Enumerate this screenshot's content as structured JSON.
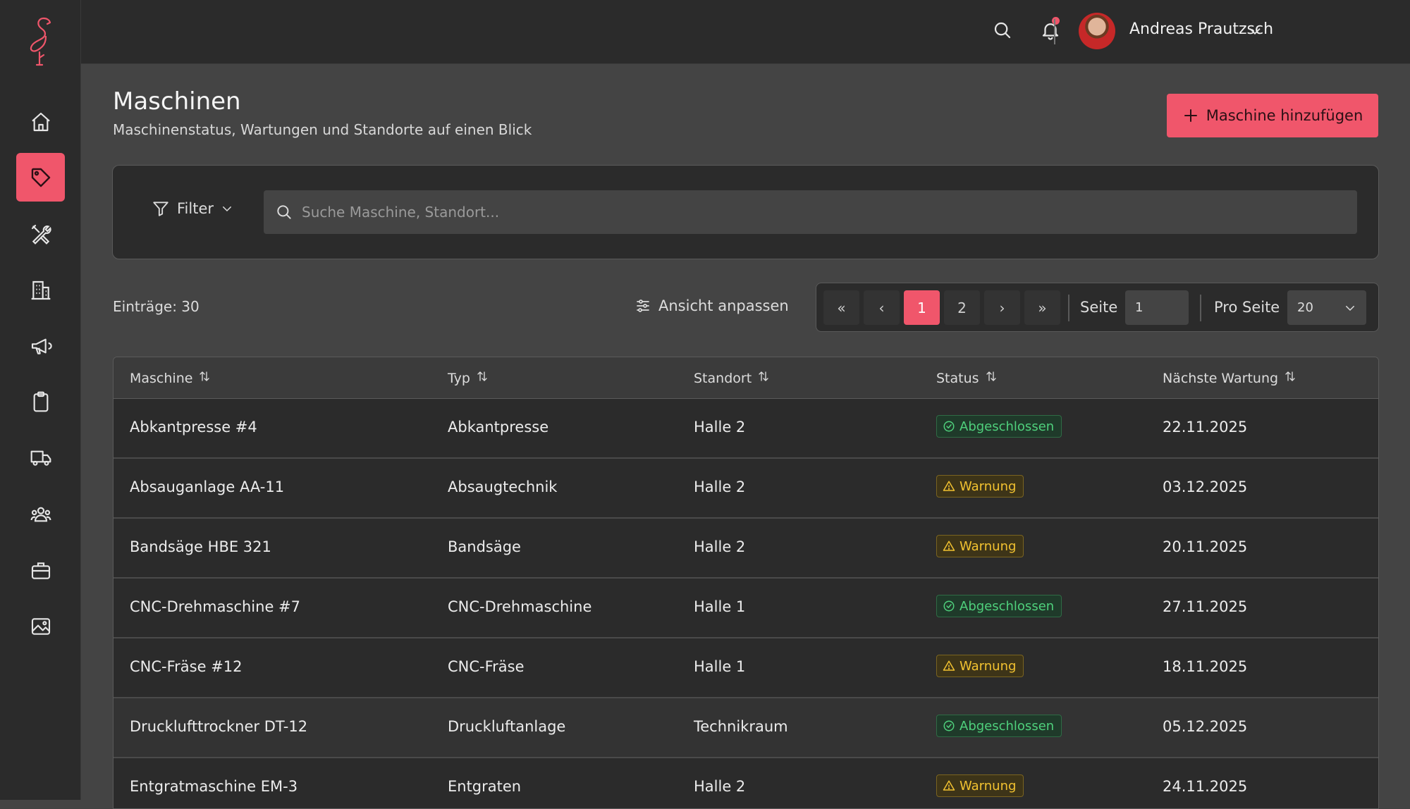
{
  "user": {
    "name": "Andreas Prautzsch"
  },
  "page": {
    "title": "Maschinen",
    "subtitle": "Maschinenstatus, Wartungen und Standorte auf einen Blick",
    "add_button": "Maschine hinzufügen"
  },
  "filter": {
    "label": "Filter",
    "search_placeholder": "Suche Maschine, Standort..."
  },
  "toolbar": {
    "entries": "Einträge: 30",
    "view_button": "Ansicht anpassen"
  },
  "pagination": {
    "first": "«",
    "prev": "‹",
    "pages": [
      "1",
      "2"
    ],
    "next": "›",
    "last": "»",
    "page_label": "Seite",
    "page_value": "1",
    "per_page_label": "Pro Seite",
    "per_page_value": "20"
  },
  "table": {
    "headers": [
      "Maschine",
      "Typ",
      "Standort",
      "Status",
      "Nächste Wartung"
    ],
    "rows": [
      [
        "Abkantpresse #4",
        "Abkantpresse",
        "Halle 2",
        "Abgeschlossen",
        "22.11.2025"
      ],
      [
        "Absauganlage AA-11",
        "Absaugtechnik",
        "Halle 2",
        "Warnung",
        "03.12.2025"
      ],
      [
        "Bandsäge HBE 321",
        "Bandsäge",
        "Halle 2",
        "Warnung",
        "20.11.2025"
      ],
      [
        "CNC-Drehmaschine #7",
        "CNC-Drehmaschine",
        "Halle 1",
        "Abgeschlossen",
        "27.11.2025"
      ],
      [
        "CNC-Fräse #12",
        "CNC-Fräse",
        "Halle 1",
        "Warnung",
        "18.11.2025"
      ],
      [
        "Drucklufttrockner DT-12",
        "Druckluftanlage",
        "Technikraum",
        "Abgeschlossen",
        "05.12.2025"
      ],
      [
        "Entgratmaschine EM-3",
        "Entgraten",
        "Halle 2",
        "Warnung",
        "24.11.2025"
      ]
    ]
  },
  "colors": {
    "accent": "#f0566b",
    "ok": "#4fd07c",
    "warn": "#f2c230"
  }
}
